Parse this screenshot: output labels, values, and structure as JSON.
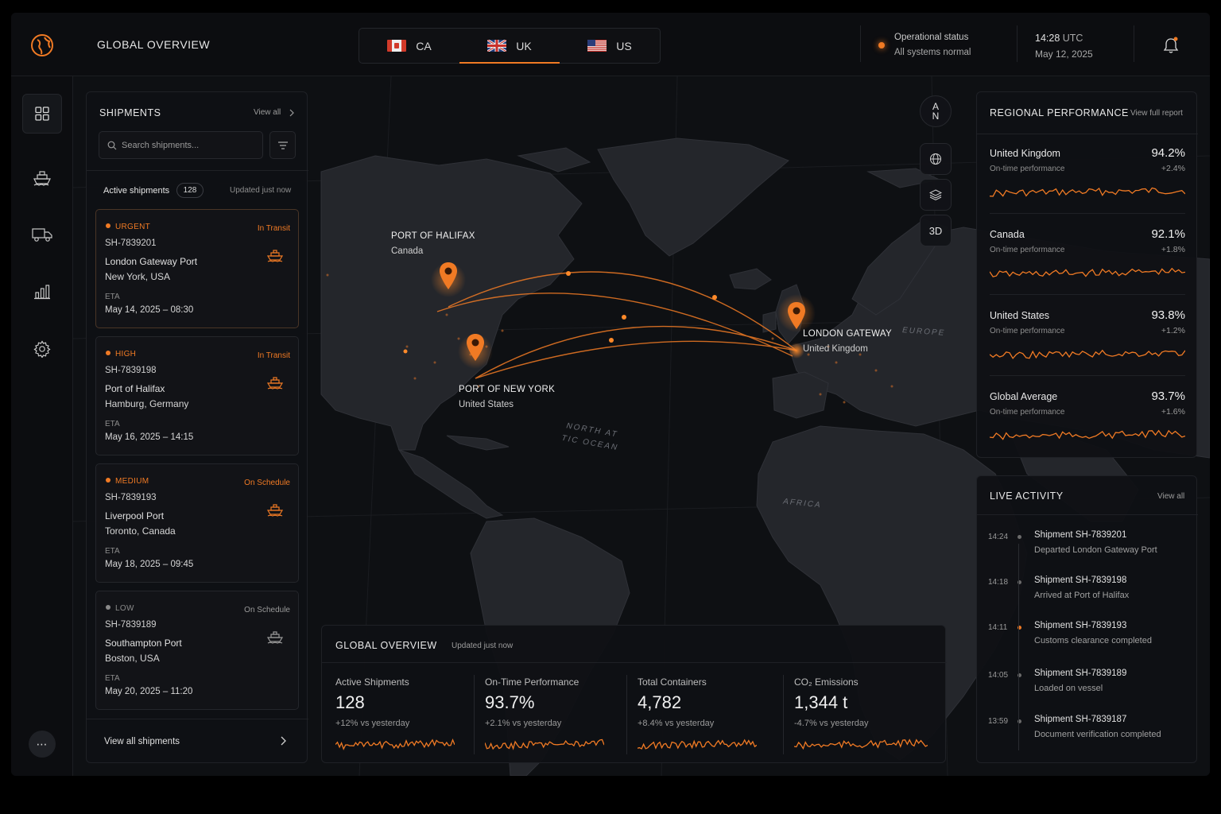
{
  "header": {
    "title": "GLOBAL OVERVIEW",
    "regions": [
      {
        "code": "CA",
        "active": false
      },
      {
        "code": "UK",
        "active": true
      },
      {
        "code": "US",
        "active": false
      }
    ],
    "status_label": "Operational status",
    "status_value": "All systems normal",
    "time": "14:28",
    "time_zone": "UTC",
    "date": "May 12, 2025"
  },
  "sidebar": {
    "items": [
      {
        "icon": "dashboard-grid-icon",
        "active": true
      },
      {
        "icon": "ship-icon",
        "active": false
      },
      {
        "icon": "truck-icon",
        "active": false
      },
      {
        "icon": "bar-chart-icon",
        "active": false
      },
      {
        "icon": "gear-icon",
        "active": false
      }
    ],
    "more_label": "⋯"
  },
  "shipments": {
    "title": "SHIPMENTS",
    "view_all": "View all",
    "search_placeholder": "Search shipments...",
    "active_label": "Active shipments",
    "active_count": "128",
    "updated": "Updated just now",
    "cards": [
      {
        "priority": "URGENT",
        "priority_color": "#f07a24",
        "status": "In Transit",
        "status_color": "#f07a24",
        "id": "SH-7839201",
        "origin": "London Gateway Port",
        "destination": "New York, USA",
        "eta_label": "ETA",
        "eta": "May 14, 2025 – 08:30"
      },
      {
        "priority": "HIGH",
        "priority_color": "#f07a24",
        "status": "In Transit",
        "status_color": "#f07a24",
        "id": "SH-7839198",
        "origin": "Port of Halifax",
        "destination": "Hamburg, Germany",
        "eta_label": "ETA",
        "eta": "May 16, 2025 – 14:15"
      },
      {
        "priority": "MEDIUM",
        "priority_color": "#f07a24",
        "status": "On Schedule",
        "status_color": "#f07a24",
        "id": "SH-7839193",
        "origin": "Liverpool Port",
        "destination": "Toronto, Canada",
        "eta_label": "ETA",
        "eta": "May 18, 2025 – 09:45"
      },
      {
        "priority": "LOW",
        "priority_color": "#8a8a8a",
        "status": "On Schedule",
        "status_color": "#9a9a9a",
        "id": "SH-7839189",
        "origin": "Southampton Port",
        "destination": "Boston, USA",
        "eta_label": "ETA",
        "eta": "May 20, 2025 – 11:20"
      }
    ],
    "footer_link": "View all shipments"
  },
  "map": {
    "controls": {
      "compass_arrow": "A",
      "compass_north": "N",
      "three_d": "3D"
    },
    "ports": [
      {
        "name": "PORT OF HALIFAX",
        "country": "Canada"
      },
      {
        "name": "PORT OF NEW YORK",
        "country": "United States"
      },
      {
        "name": "LONDON GATEWAY",
        "country": "United Kingdom"
      }
    ],
    "regions": {
      "europe": "EUROPE",
      "ocean_line1": "NORTH AT",
      "ocean_line2": "TIC OCEAN",
      "africa": "AFRICA"
    }
  },
  "regional_performance": {
    "title": "REGIONAL PERFORMANCE",
    "link": "View full report",
    "rows": [
      {
        "name": "United Kingdom",
        "sub": "On-time performance",
        "value": "94.2%",
        "delta": "+2.4%"
      },
      {
        "name": "Canada",
        "sub": "On-time performance",
        "value": "92.1%",
        "delta": "+1.8%"
      },
      {
        "name": "United States",
        "sub": "On-time performance",
        "value": "93.8%",
        "delta": "+1.2%"
      },
      {
        "name": "Global Average",
        "sub": "On-time performance",
        "value": "93.7%",
        "delta": "+1.6%"
      }
    ]
  },
  "live_activity": {
    "title": "LIVE ACTIVITY",
    "link": "View all",
    "items": [
      {
        "time": "14:24",
        "title": "Shipment SH-7839201",
        "desc": "Departed London Gateway Port",
        "accent": false
      },
      {
        "time": "14:18",
        "title": "Shipment SH-7839198",
        "desc": "Arrived at Port of Halifax",
        "accent": false
      },
      {
        "time": "14:11",
        "title": "Shipment SH-7839193",
        "desc": "Customs clearance completed",
        "accent": true
      },
      {
        "time": "14:05",
        "title": "Shipment SH-7839189",
        "desc": "Loaded on vessel",
        "accent": false
      },
      {
        "time": "13:59",
        "title": "Shipment SH-7839187",
        "desc": "Document verification completed",
        "accent": false
      }
    ]
  },
  "global_overview": {
    "title": "GLOBAL OVERVIEW",
    "updated": "Updated just now",
    "kpis": [
      {
        "label": "Active Shipments",
        "value": "128",
        "delta": "+12% vs yesterday"
      },
      {
        "label": "On-Time Performance",
        "value": "93.7%",
        "delta": "+2.1% vs yesterday"
      },
      {
        "label": "Total Containers",
        "value": "4,782",
        "delta": "+8.4% vs yesterday"
      },
      {
        "label": "CO₂ Emissions",
        "value": "1,344 t",
        "delta": "-4.7% vs yesterday"
      }
    ]
  },
  "colors": {
    "accent": "#f07a24",
    "background": "#0d0e11",
    "panel": "#0f1014"
  }
}
